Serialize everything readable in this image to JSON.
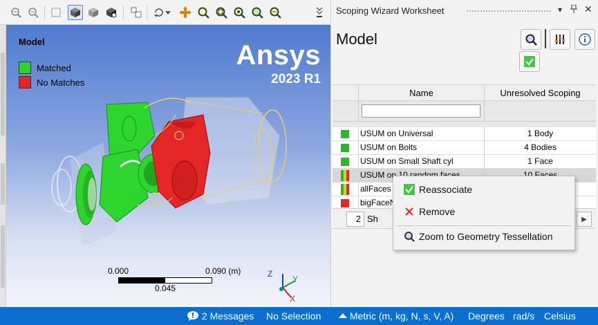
{
  "viewport": {
    "title": "Model",
    "legend": [
      {
        "label": "Matched",
        "color": "#2fd52f"
      },
      {
        "label": "No Matches",
        "color": "#e42626"
      }
    ],
    "brand": {
      "name": "Ansys",
      "version": "2023 R1"
    },
    "scale": {
      "min": "0.000",
      "max": "0.090 (m)",
      "mid": "0.045"
    },
    "triad": {
      "x": "X",
      "y": "Y",
      "z": "Z"
    }
  },
  "panel": {
    "title": "Scoping Wizard Worksheet",
    "heading": "Model",
    "grid": {
      "columns": [
        "Name",
        "Unresolved Scoping"
      ],
      "filter_value": "",
      "rows": [
        {
          "status": "matched",
          "name": "USUM on Universal",
          "unresolved": "1 Body"
        },
        {
          "status": "matched",
          "name": "USUM on Bolts",
          "unresolved": "4 Bodies"
        },
        {
          "status": "matched",
          "name": "USUM on Small Shaft cyl",
          "unresolved": "1 Face"
        },
        {
          "status": "partial",
          "name": "USUM on 10 random faces",
          "unresolved": "10 Faces"
        },
        {
          "status": "partial",
          "name": "allFaces",
          "unresolved": ""
        },
        {
          "status": "nomatch",
          "name": "bigFaceN",
          "unresolved": ""
        }
      ]
    },
    "pager": {
      "page": "2",
      "label": "Sh"
    }
  },
  "context_menu": {
    "items": [
      {
        "label": "Reassociate",
        "icon": "check-icon"
      },
      {
        "label": "Remove",
        "icon": "close-icon"
      },
      {
        "label": "Zoom to Geometry Tessellation",
        "icon": "zoom-icon"
      }
    ]
  },
  "statusbar": {
    "messages": "2 Messages",
    "selection": "No Selection",
    "units": "Metric (m, kg, N, s, V, A)",
    "angle": "Degrees",
    "rotation": "rad/s",
    "temperature": "Celsius"
  }
}
